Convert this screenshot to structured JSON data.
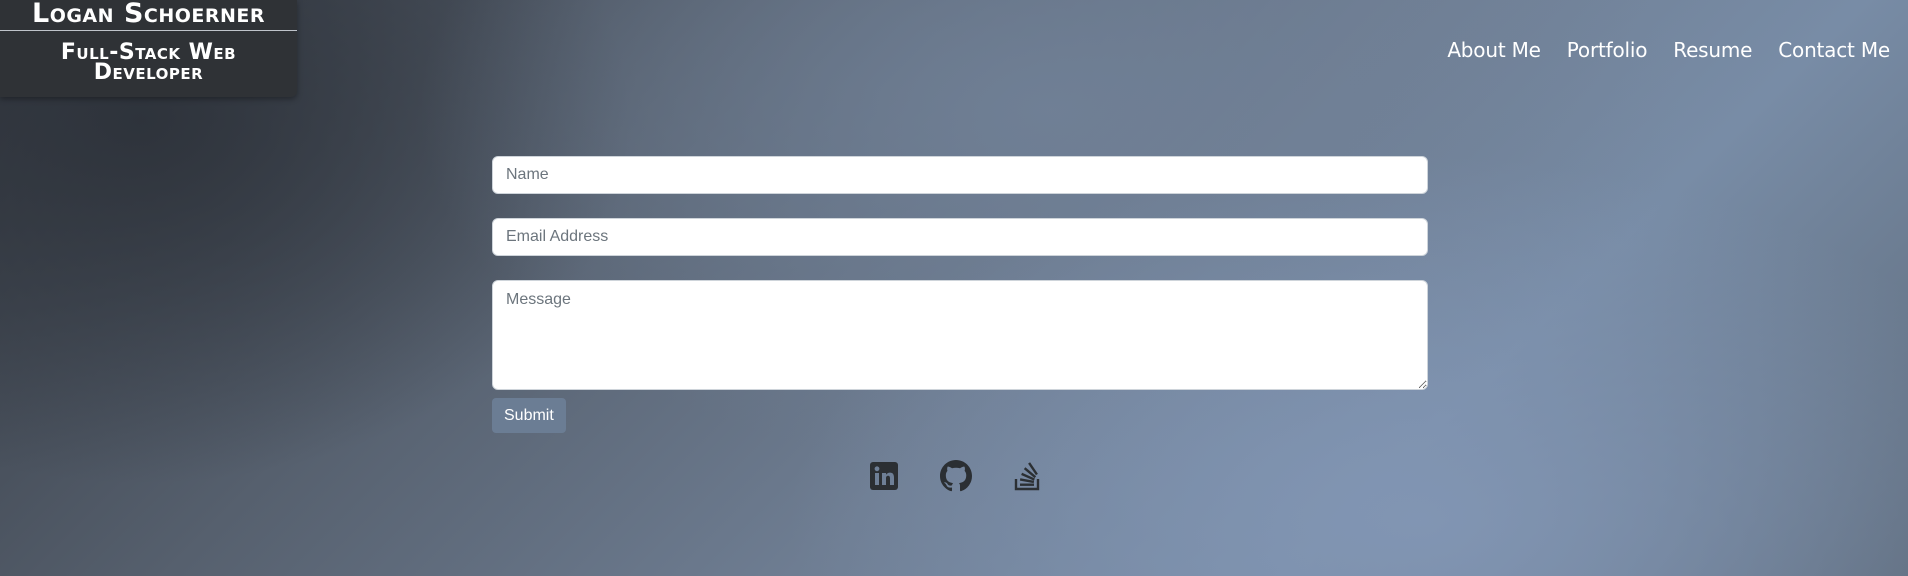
{
  "header": {
    "name": "Logan Schoerner",
    "title": "Full-Stack Web Developer"
  },
  "nav": {
    "items": [
      "About Me",
      "Portfolio",
      "Resume",
      "Contact Me"
    ]
  },
  "form": {
    "name_placeholder": "Name",
    "email_placeholder": "Email Address",
    "message_placeholder": "Message",
    "submit_label": "Submit"
  },
  "social": {
    "icons": [
      "linkedin-icon",
      "github-icon",
      "stack-overflow-icon"
    ],
    "icon_color": "#2b2f33"
  },
  "colors": {
    "brand_bg": "#2f3236",
    "submit_bg": "#6b7d94"
  }
}
